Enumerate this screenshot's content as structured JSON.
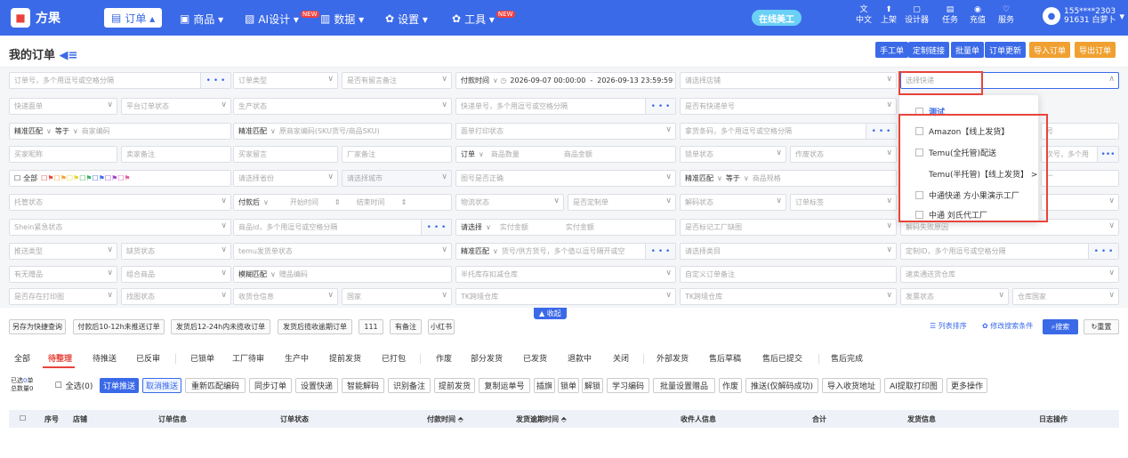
{
  "nav": {
    "logo_text": "方果",
    "items": [
      {
        "label": "订单 ▴",
        "icon": "orders-icon"
      },
      {
        "label": "商品 ▾",
        "icon": "goods-icon"
      },
      {
        "label": "AI设计 ▾",
        "icon": "ai-design-icon",
        "badge": "NEW"
      },
      {
        "label": "数据 ▾",
        "icon": "data-icon"
      },
      {
        "label": "设置 ▾",
        "icon": "gear-icon"
      },
      {
        "label": "工具 ▾",
        "icon": "tools-icon",
        "badge": "NEW"
      }
    ],
    "online_label": "在线美工",
    "right_items": [
      {
        "label": "中文",
        "icon": "translate-icon"
      },
      {
        "label": "上架",
        "icon": "upload-icon"
      },
      {
        "label": "设计器",
        "icon": "designer-icon"
      },
      {
        "label": "任务",
        "icon": "task-icon"
      },
      {
        "label": "充值",
        "icon": "recharge-icon"
      },
      {
        "label": "服务",
        "icon": "service-icon"
      }
    ],
    "user_phone": "155****2303",
    "user_name": "91631 白萝卜"
  },
  "page": {
    "title": "我的订单",
    "top_buttons": [
      {
        "label": "手工单",
        "color": "#3b6ae8"
      },
      {
        "label": "定制链接",
        "color": "#3b6ae8"
      },
      {
        "label": "批量单",
        "color": "#3b6ae8"
      },
      {
        "label": "订单更新",
        "color": "#3b6ae8"
      },
      {
        "label": "导入订单",
        "color": "#f0a030"
      },
      {
        "label": "导出订单",
        "color": "#f0a030"
      }
    ]
  },
  "filters": {
    "r1": [
      "订单号，多个用逗号或空格分隔",
      "订单类型",
      "是否有留言备注",
      "付款时间",
      "2026-09-07 00:00:00",
      "-",
      "2026-09-13 23:59:59",
      "请选择店铺",
      "选择快递"
    ],
    "r2": [
      "快递面单",
      "平台订单状态",
      "生产状态",
      "快递单号，多个用逗号或空格分隔",
      "是否有快递单号"
    ],
    "r3": [
      "精准匹配",
      "等于",
      "商家编码",
      "精准匹配",
      "原商家编码(SKU货号/商品SKU)",
      "面单打印状态",
      "拿货条码，多个用逗号或空格分隔",
      "号"
    ],
    "r4": [
      "买家昵称",
      "卖家备注",
      "买家留言",
      "厂家备注",
      "订单",
      "商品数量",
      "商品金额",
      "锁单状态",
      "作废状态",
      "次号，多个用"
    ],
    "r5": [
      "全部",
      "请选择省份",
      "请选择城市",
      "图号是否正确",
      "精准匹配",
      "等于",
      "商品规格",
      "厂"
    ],
    "r6": [
      "托管状态",
      "付款后",
      "开始时间",
      "结束时间",
      "物流状态",
      "是否定制单",
      "解码状态",
      "订单标签"
    ],
    "r7": [
      "Shein紧急状态",
      "商品id，多个用逗号或空格分隔",
      "请选择",
      "实付金额",
      "实付金额",
      "是否标记工厂缺图",
      "解码失败原因"
    ],
    "r8": [
      "推送类型",
      "缺货状态",
      "temu发货单状态",
      "精准匹配",
      "货号/供方货号，多个值以逗号隔开或空",
      "请选择类目",
      "定制ID，多个用逗号或空格分隔"
    ],
    "r9": [
      "有无赠品",
      "组合商品",
      "模糊匹配",
      "赠品编码",
      "半托库存扣减仓库",
      "自定义订单备注",
      "速卖通送货仓库"
    ],
    "r10": [
      "是否存在打印图",
      "找图状态",
      "收货仓信息",
      "国家",
      "TK跨境仓库",
      "TK跨境仓库",
      "发票状态",
      "仓库国家"
    ],
    "collapse_label": "▲ 收起"
  },
  "dropdown": {
    "options": [
      {
        "label": "测试",
        "highlight": true
      },
      {
        "label": "Amazon【线上发货】"
      },
      {
        "label": "Temu(全托管)配送"
      },
      {
        "label": "Temu(半托管)【线上发货】  >"
      },
      {
        "label": "中通快递 方小果演示工厂"
      },
      {
        "label": "中通 刘氏代工厂"
      }
    ]
  },
  "quick": {
    "buttons": [
      "另存为快捷查询",
      "付款后10-12h未推送订单",
      "发货后12-24h内未揽收订单",
      "发货后揽收逾期订单",
      "111",
      "有备注",
      "小红书"
    ],
    "sort_label": "列表排序",
    "modify_label": "修改搜索条件",
    "search_label": "搜索",
    "reset_label": "重置"
  },
  "tabs": [
    "全部",
    "待整理",
    "待推送",
    "已反审",
    "已锁单",
    "工厂待审",
    "生产中",
    "提前发货",
    "已打包",
    "作废",
    "部分发货",
    "已发货",
    "退款中",
    "关闭",
    "外部发货",
    "售后草稿",
    "售后已提交",
    "售后完成"
  ],
  "actions": {
    "selected_label": "已选",
    "selected_count": "0",
    "selected_unit": "单",
    "total_label": "总数量",
    "total_count": "0",
    "select_all": "全选(0)",
    "buttons": [
      "订单推送",
      "取消推送",
      "重新匹配编码",
      "同步订单",
      "设置快递",
      "智能解码",
      "识别备注",
      "提前发货",
      "复制运单号",
      "插旗",
      "锁单",
      "解锁",
      "学习编码",
      "批量设置赠品",
      "作废",
      "推送(仅解码成功)",
      "导入收货地址",
      "AI提取打印图",
      "更多操作"
    ]
  },
  "table": {
    "headers": [
      "序号",
      "店铺",
      "订单信息",
      "订单状态",
      "付款时间 ⬘",
      "发货逾期时间 ⬘",
      "收件人信息",
      "合计",
      "发货信息",
      "日志操作"
    ]
  }
}
